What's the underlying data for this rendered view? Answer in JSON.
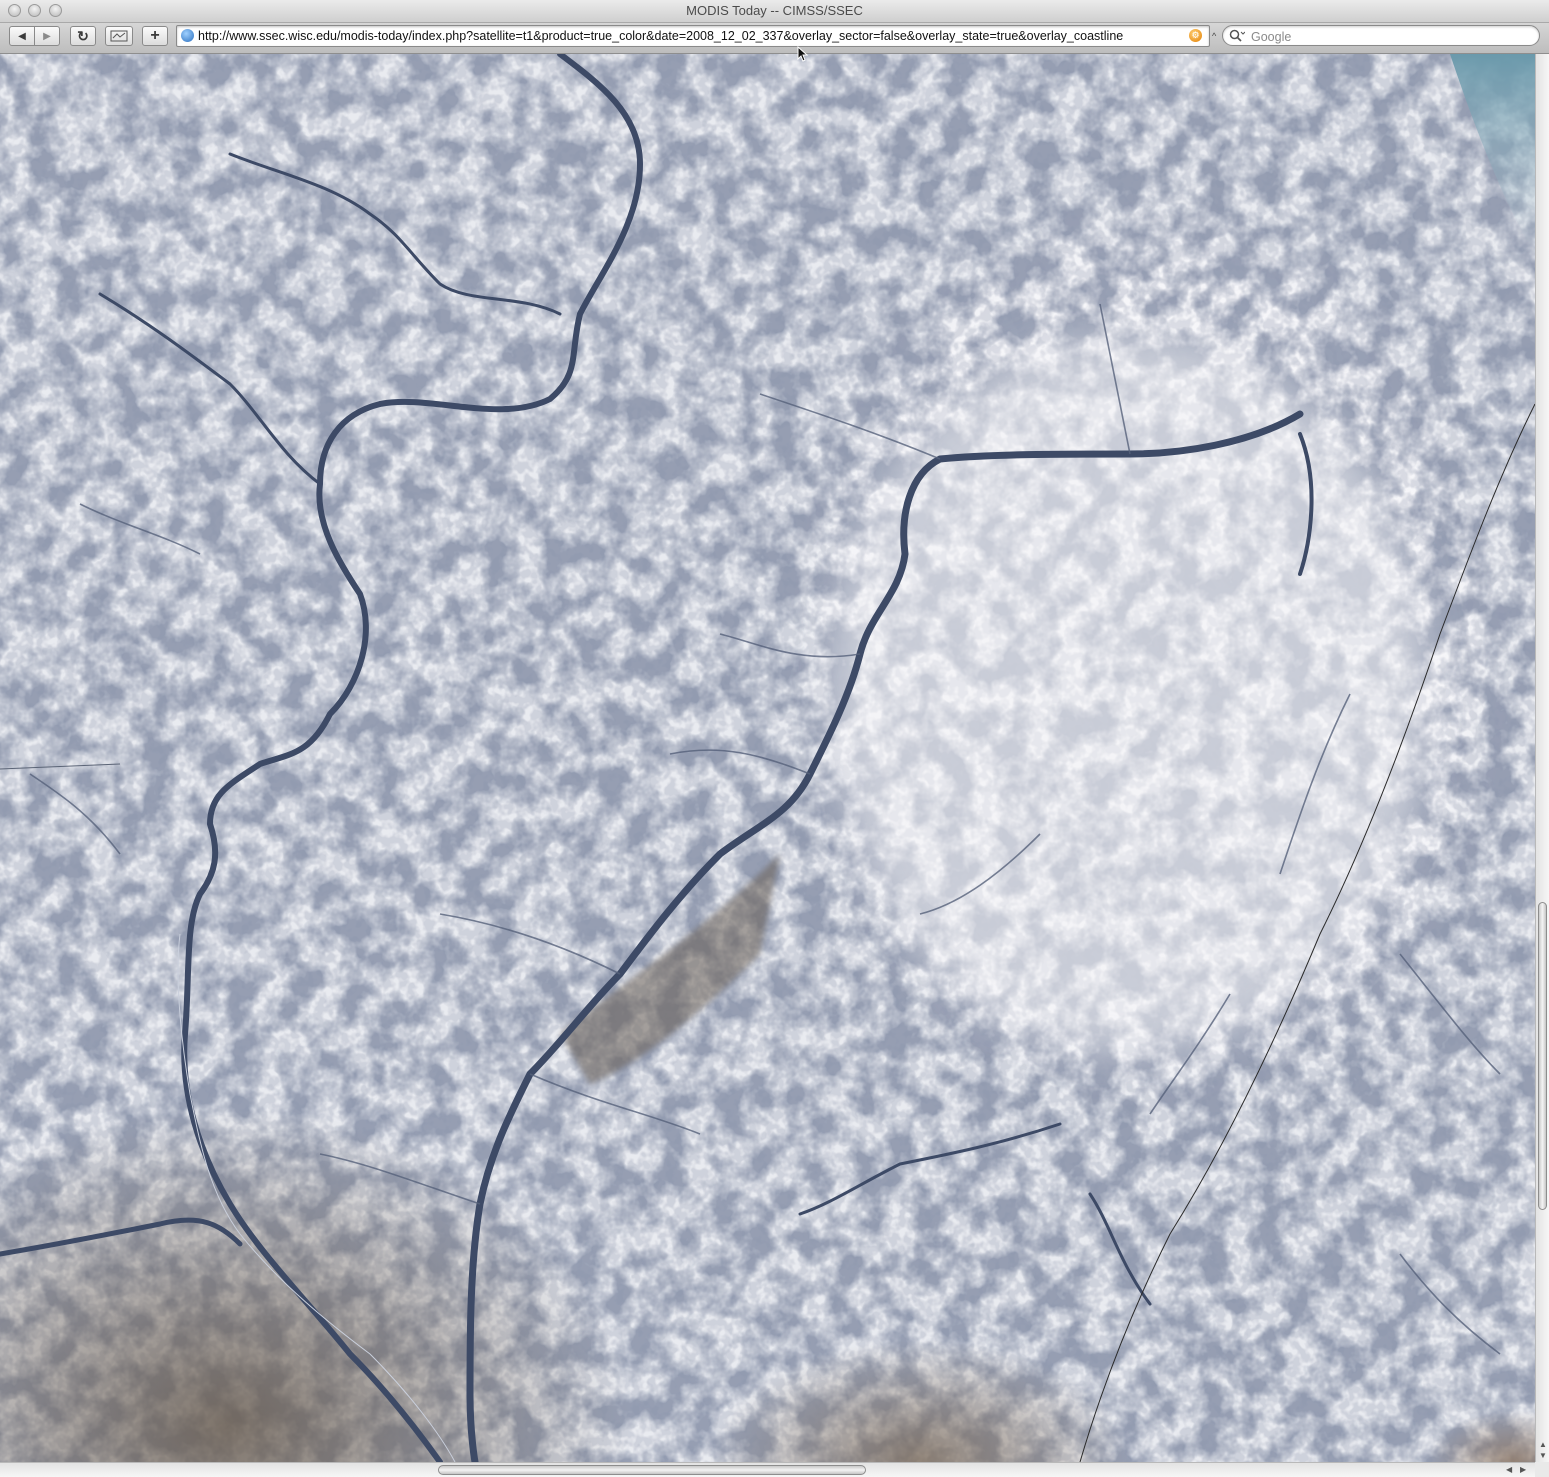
{
  "window": {
    "title": "MODIS Today -- CIMSS/SSEC",
    "controls": [
      "close-button",
      "minimize-button",
      "zoom-button"
    ]
  },
  "toolbar": {
    "back_label": "◀",
    "forward_label": "▶",
    "reload_label": "↻",
    "add_bookmark_label": "+",
    "url": "http://www.ssec.wisc.edu/modis-today/index.php?satellite=t1&product=true_color&date=2008_12_02_337&overlay_sector=false&overlay_state=true&overlay_coastline",
    "search_placeholder": "Google"
  },
  "content": {
    "image_description_icon": "satellite-image",
    "colors": {
      "snow": "#eceef3",
      "river": "#3a4660",
      "bare_ground": "#6b6157",
      "water_top_right": "#7aa6b7"
    }
  }
}
